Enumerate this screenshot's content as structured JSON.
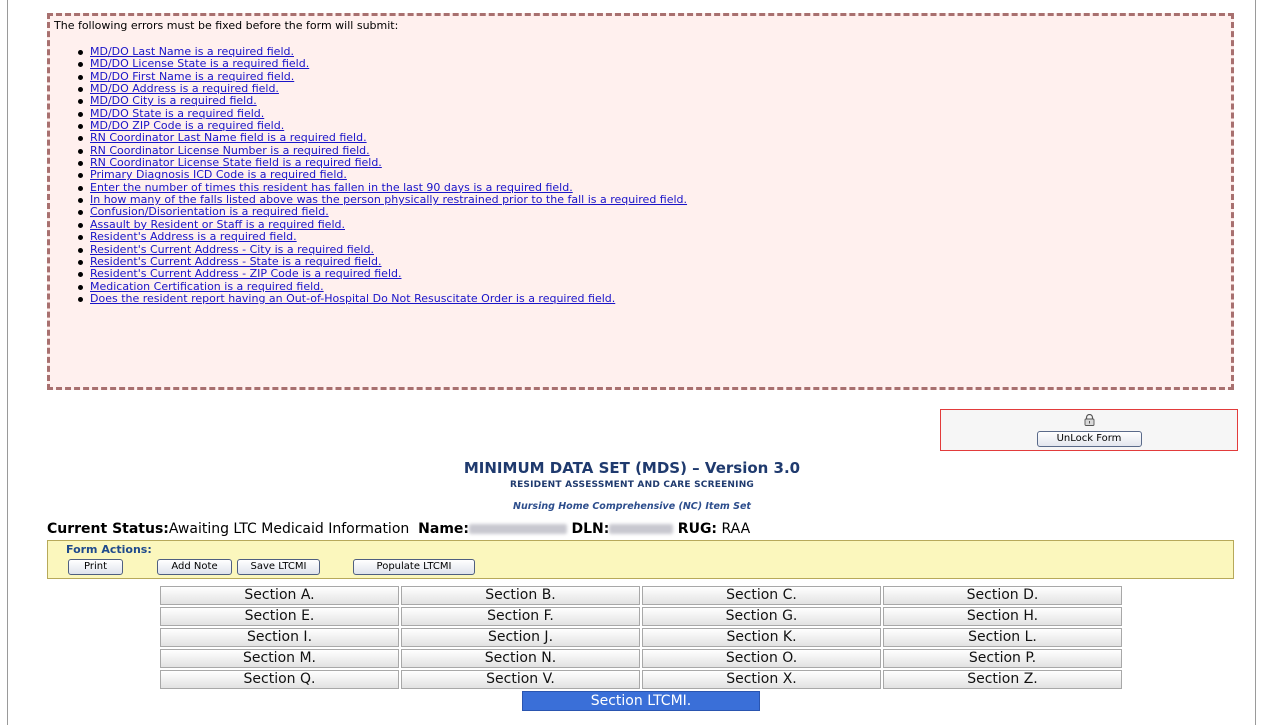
{
  "errors": {
    "intro": "The following errors must be fixed before the form will submit:",
    "items": [
      "MD/DO Last Name is a required field.",
      "MD/DO License State is a required field.",
      "MD/DO First Name is a required field.",
      "MD/DO Address is a required field.",
      "MD/DO City is a required field.",
      "MD/DO State is a required field.",
      "MD/DO ZIP Code is a required field.",
      "RN Coordinator Last Name field is a required field.",
      "RN Coordinator License Number is a required field.",
      "RN Coordinator License State field is a required field.",
      "Primary Diagnosis ICD Code is a required field.",
      "Enter the number of times this resident has fallen in the last 90 days is a required field.",
      "In how many of the falls listed above was the person physically restrained prior to the fall is a required field.",
      "Confusion/Disorientation is a required field.",
      "Assault by Resident or Staff is a required field.",
      "Resident's Address is a required field.",
      "Resident's Current Address - City is a required field.",
      "Resident's Current Address - State is a required field.",
      "Resident's Current Address - ZIP Code is a required field.",
      "Medication Certification is a required field.",
      "Does the resident report having an Out-of-Hospital Do Not Resuscitate Order is a required field."
    ]
  },
  "unlock": {
    "button_label": "UnLock Form"
  },
  "header": {
    "title": "MINIMUM DATA SET (MDS) – Version 3.0",
    "subtitle": "RESIDENT ASSESSMENT AND CARE SCREENING",
    "item_set": "Nursing Home Comprehensive (NC) Item Set"
  },
  "status": {
    "status_label": "Current Status:",
    "status_value": "Awaiting LTC Medicaid Information",
    "name_label": "Name:",
    "dln_label": "DLN:",
    "rug_label": "RUG:",
    "rug_value": "RAA"
  },
  "form_actions": {
    "label": "Form Actions:",
    "print": "Print",
    "add_note": "Add Note",
    "save_ltcmi": "Save LTCMI",
    "populate_ltcmi": "Populate LTCMI"
  },
  "sections": [
    "Section A.",
    "Section B.",
    "Section C.",
    "Section D.",
    "Section E.",
    "Section F.",
    "Section G.",
    "Section H.",
    "Section I.",
    "Section J.",
    "Section K.",
    "Section L.",
    "Section M.",
    "Section N.",
    "Section O.",
    "Section P.",
    "Section Q.",
    "Section V.",
    "Section X.",
    "Section Z."
  ],
  "active_section": "Section LTCMI.",
  "colors": {
    "error_border": "#a8706f",
    "error_bg": "#fff0ee",
    "link": "#1a14c8",
    "title": "#1f3a6e",
    "actions_bg": "#fbf7bd",
    "active_section_bg": "#3a6fd8"
  }
}
